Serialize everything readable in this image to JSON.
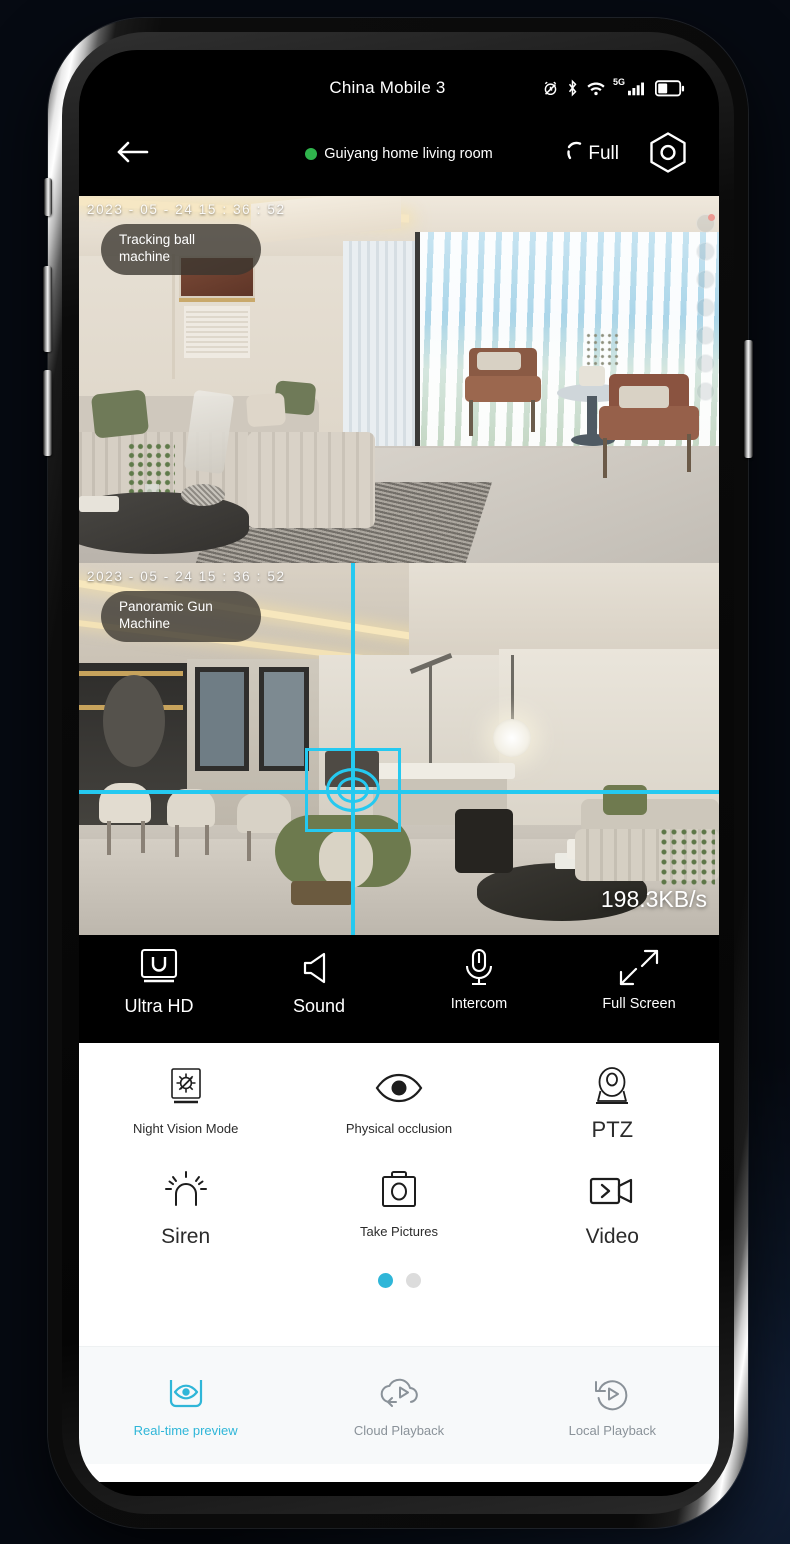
{
  "status_bar": {
    "carrier": "China Mobile 3",
    "icons": [
      "alarm-icon",
      "bluetooth-icon",
      "wifi-icon",
      "signal-bars-icon",
      "battery-icon"
    ],
    "network_label": "5G"
  },
  "header": {
    "back_icon": "arrow-left-icon",
    "device_name": "Guiyang home living room",
    "online_status_color": "#2fb44c",
    "full_label": "Full",
    "settings_icon": "hexagon-settings-icon"
  },
  "feeds": [
    {
      "id": "tracking-ball",
      "timestamp": "2023 - 05 - 24   15 : 36 : 52",
      "badge": "Tracking ball machine",
      "scene": "living room with sectional sofa, armchairs and floor-to-ceiling window blinds"
    },
    {
      "id": "panoramic-gun",
      "timestamp": "2023 - 05 - 24   15 : 36 : 52",
      "badge": "Panoramic Gun Machine",
      "scene": "open-plan living and dining area with green ottoman",
      "bandwidth": "198.3KB/s",
      "crosshair_color": "#25c9f0"
    }
  ],
  "control_bar": [
    {
      "icon": "ultra-hd-icon",
      "label": "Ultra HD",
      "size": "large"
    },
    {
      "icon": "speaker-icon",
      "label": "Sound",
      "size": "large"
    },
    {
      "icon": "microphone-icon",
      "label": "Intercom",
      "size": "small"
    },
    {
      "icon": "fullscreen-arrows-icon",
      "label": "Full Screen",
      "size": "small"
    }
  ],
  "functions": {
    "row1": [
      {
        "icon": "night-vision-icon",
        "label": "Night Vision Mode",
        "size": "normal"
      },
      {
        "icon": "eye-icon",
        "label": "Physical occlusion",
        "size": "normal"
      },
      {
        "icon": "ptz-camera-icon",
        "label": "PTZ",
        "size": "big"
      }
    ],
    "row2": [
      {
        "icon": "siren-icon",
        "label": "Siren",
        "size": "mid"
      },
      {
        "icon": "camera-icon",
        "label": "Take Pictures",
        "size": "normal"
      },
      {
        "icon": "video-camera-icon",
        "label": "Video",
        "size": "mid"
      }
    ],
    "pager": {
      "total": 2,
      "active_index": 0,
      "active_color": "#2fb6d8",
      "inactive_color": "#dcdcdc"
    }
  },
  "bottom_nav": [
    {
      "icon": "preview-eye-icon",
      "label": "Real-time preview",
      "active": true
    },
    {
      "icon": "cloud-play-icon",
      "label": "Cloud Playback",
      "active": false
    },
    {
      "icon": "history-play-icon",
      "label": "Local Playback",
      "active": false
    }
  ],
  "accent_color": "#2fb6d8"
}
